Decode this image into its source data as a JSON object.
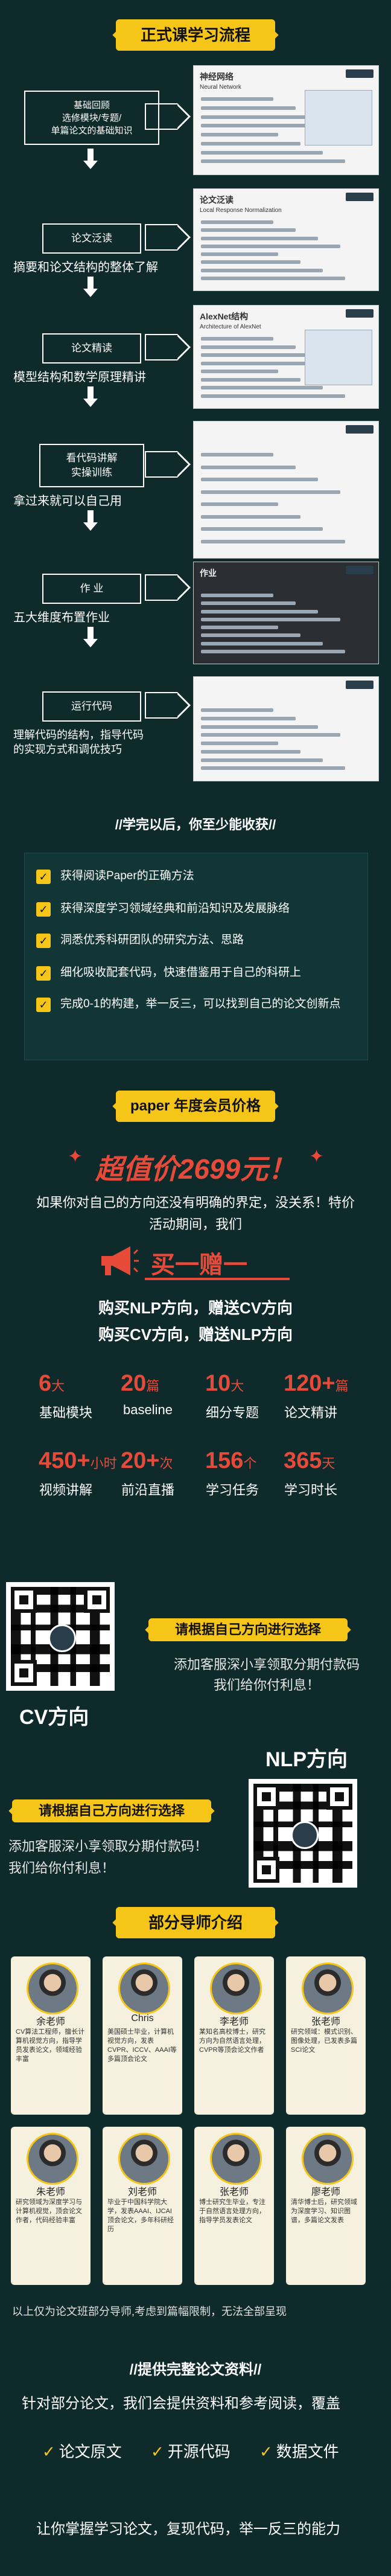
{
  "section1": {
    "title": "正式课学习流程",
    "steps": [
      {
        "box": "基础回顾\n选修模块/专题/\n单篇论文的基础知识",
        "text": ""
      },
      {
        "box": "论文泛读",
        "text": "摘要和论文结构的整体了解"
      },
      {
        "box": "论文精读",
        "text": "模型结构和数学原理精讲"
      },
      {
        "box": "看代码讲解\n实操训练",
        "text": "拿过来就可以自己用"
      },
      {
        "box": "作  业",
        "text": "五大维度布置作业"
      },
      {
        "box": "运行代码",
        "text": "理解代码的结构，指导代码\n的实现方式和调优技巧"
      }
    ],
    "shots": [
      {
        "title": "神经网络",
        "subtitle": "Neural Network"
      },
      {
        "title": "论文泛读",
        "subtitle": "Local Response Normalization"
      },
      {
        "title": "AlexNet结构",
        "subtitle": "Architecture of AlexNet"
      },
      {
        "title": "",
        "subtitle": ""
      },
      {
        "title": "作业",
        "subtitle": ""
      },
      {
        "title": "",
        "subtitle": ""
      }
    ]
  },
  "section2": {
    "header": "//学完以后，你至少能收获//",
    "items": [
      "获得阅读Paper的正确方法",
      "获得深度学习领域经典和前沿知识及发展脉络",
      "洞悉优秀科研团队的研究方法、思路",
      "细化吸收配套代码，快速借鉴用于自己的科研上",
      "完成0-1的构建，举一反三，可以找到自己的论文创新点"
    ]
  },
  "section3": {
    "title": "paper 年度会员价格",
    "price": "超值价2699元！",
    "desc": "如果你对自己的方向还没有明确的界定，没关系！特价活动期间，我们",
    "promo": "买一赠一",
    "offer1": "购买NLP方向，赠送CV方向",
    "offer2": "购买CV方向，赠送NLP方向",
    "stats": [
      {
        "num": "6",
        "unit": "大",
        "label": "基础模块"
      },
      {
        "num": "20",
        "unit": "篇",
        "label": "baseline"
      },
      {
        "num": "10",
        "unit": "大",
        "label": "细分专题"
      },
      {
        "num": "120+",
        "unit": "篇",
        "label": "论文精讲"
      },
      {
        "num": "450+",
        "unit": "小时",
        "label": "视频讲解"
      },
      {
        "num": "20+",
        "unit": "次",
        "label": "前沿直播"
      },
      {
        "num": "156",
        "unit": "个",
        "label": "学习任务"
      },
      {
        "num": "365",
        "unit": "天",
        "label": "学习时长"
      }
    ]
  },
  "section4": {
    "cv_label": "CV方向",
    "nlp_label": "NLP方向",
    "tag": "请根据自己方向进行选择",
    "tip1": "添加客服深小享领取分期付款码\n我们给你付利息！",
    "tip2": "添加客服深小享领取分期付款码！\n我们给你付利息！"
  },
  "section5": {
    "title": "部分导师介绍",
    "teachers": [
      {
        "name": "余老师",
        "desc": "CV算法工程师，擅长计算机视觉方向，指导学员发表论文，领域经验丰富"
      },
      {
        "name": "Chris",
        "desc": "美国硕士毕业，计算机视觉方向，发表CVPR、ICCV、AAAI等多篇顶会论文"
      },
      {
        "name": "李老师",
        "desc": "某知名高校博士，研究方向为自然语言处理，CVPR等顶会论文作者"
      },
      {
        "name": "张老师",
        "desc": "研究领域：模式识别、图像处理，已发表多篇SCI论文"
      },
      {
        "name": "朱老师",
        "desc": "研究领域为深度学习与计算机视觉，顶会论文作者，代码经验丰富"
      },
      {
        "name": "刘老师",
        "desc": "毕业于中国科学院大学，发表AAAI、IJCAI顶会论文，多年科研经历"
      },
      {
        "name": "张老师",
        "desc": "博士研究生毕业，专注于自然语言处理方向，指导学员发表论文"
      },
      {
        "name": "廖老师",
        "desc": "清华博士后，研究领域为深度学习、知识图谱，多篇论文发表"
      }
    ],
    "footnote": "以上仅为论文班部分导师,考虑到篇幅限制，无法全部呈现"
  },
  "section6": {
    "header": "//提供完整论文资料//",
    "intro": "针对部分论文，我们会提供资料和参考阅读，覆盖",
    "items": [
      "论文原文",
      "开源代码",
      "数据文件"
    ],
    "outro": "让你掌握学习论文，复现代码，举一反三的能力"
  },
  "colors": {
    "accent": "#f5c518",
    "bg": "#0f2a2b",
    "price_red": "#e84a3a"
  }
}
